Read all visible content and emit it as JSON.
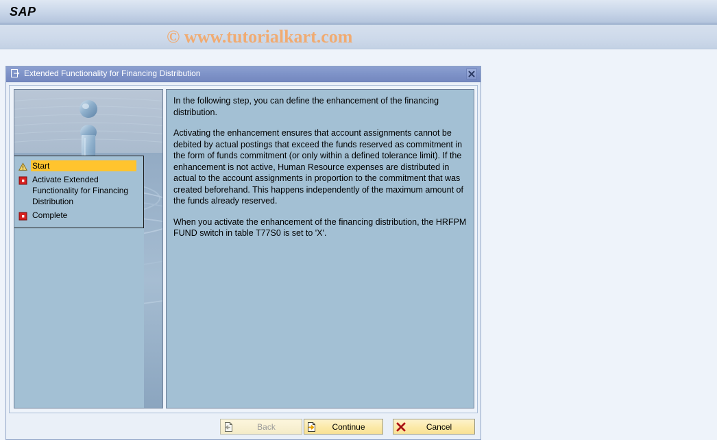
{
  "header": {
    "logo": "SAP",
    "watermark": "© www.tutorialkart.com"
  },
  "dialog": {
    "title": "Extended Functionality for Financing Distribution",
    "title_icon": "window-arrow-icon",
    "close_icon": "close-icon",
    "steps": [
      {
        "label": "Start",
        "icon": "warning-triangle-icon",
        "state": "active"
      },
      {
        "label": "Activate Extended Functionality for Financing Distribution",
        "icon": "red-square-icon",
        "state": "pending"
      },
      {
        "label": "Complete",
        "icon": "red-square-icon",
        "state": "pending"
      }
    ],
    "paragraphs": [
      "In the following step, you can define the enhancement of the financing distribution.",
      "Activating the enhancement ensures that account assignments cannot be debited by actual postings that exceed the funds reserved as commitment in the form of funds commitment (or only within a defined tolerance limit). If the enhancement is not active, Human Resource expenses are distributed in actual to the account assignments in proportion to the commitment that was created beforehand. This happens independently of the maximum amount of the funds already reserved.",
      "When you activate the enhancement of the financing distribution, the HRFPM FUND switch in table T77S0 is set to 'X'."
    ],
    "buttons": {
      "back": {
        "label": "Back",
        "icon": "page-left-arrow-icon",
        "enabled": false
      },
      "continue": {
        "label": "Continue",
        "icon": "page-right-arrow-icon",
        "enabled": true
      },
      "cancel": {
        "label": "Cancel",
        "icon": "red-x-icon",
        "enabled": true
      }
    }
  },
  "colors": {
    "panel_blue": "#a3c0d4",
    "titlebar_blue": "#7e93c8",
    "highlight_yellow": "#ffc42e",
    "button_yellow": "#fbe9a8",
    "watermark_orange": "#f0ab72"
  }
}
